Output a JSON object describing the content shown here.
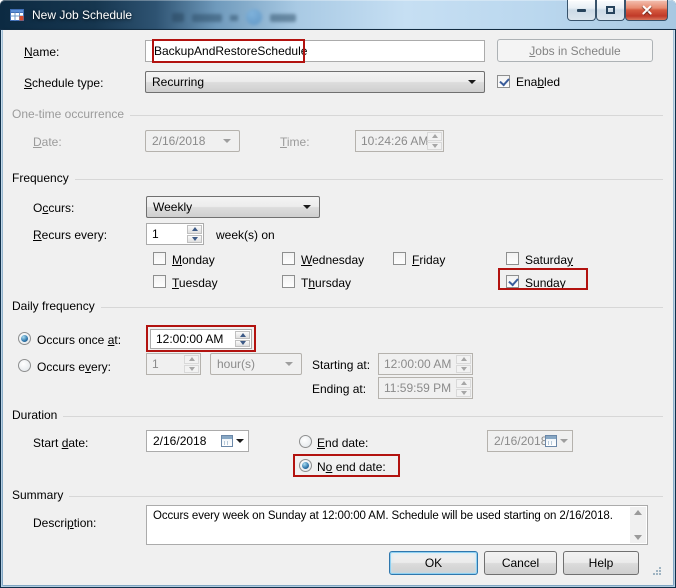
{
  "colors": {
    "annotation": "#b2120f",
    "titlebar_accent": "#a9cae4",
    "client_bg": "#f0f0f0"
  },
  "window": {
    "title": "New Job Schedule"
  },
  "icons": {
    "app": "schedule-grid-icon",
    "minimize": "minimize-icon",
    "maximize": "maximize-icon",
    "close": "close-icon",
    "combo_arrow": "chevron-down-icon",
    "calendar": "calendar-icon",
    "spin_up": "arrow-up-icon",
    "spin_down": "arrow-down-icon",
    "resize": "resize-grip-icon"
  },
  "header": {
    "name_label": "&Name:",
    "name_value": "BackupAndRestoreSchedule",
    "jobs_in_schedule_button": "&Jobs in Schedule",
    "schedule_type_label": "&Schedule type:",
    "schedule_type_value": "Recurring",
    "enabled_label": "Ena&bled",
    "enabled_checked": true
  },
  "one_time": {
    "title": "One-time occurrence",
    "date_label": "&Date:",
    "date_value": "2/16/2018",
    "time_label": "&Time:",
    "time_value": "10:24:26 AM"
  },
  "frequency": {
    "title": "Frequency",
    "occurs_label": "O&ccurs:",
    "occurs_value": "Weekly",
    "recurs_label": "&Recurs every:",
    "recurs_value": "1",
    "recurs_suffix": "week(s) on",
    "days": [
      {
        "label": "&Monday",
        "checked": false
      },
      {
        "label": "&Tuesday",
        "checked": false
      },
      {
        "label": "&Wednesday",
        "checked": false
      },
      {
        "label": "T&hursday",
        "checked": false
      },
      {
        "label": "&Friday",
        "checked": false
      },
      {
        "label": "Saturda&y",
        "checked": false
      },
      {
        "label": "S&unday",
        "checked": true
      }
    ]
  },
  "daily": {
    "title": "Daily frequency",
    "once_label": "Occurs once &at:",
    "once_selected": true,
    "once_value": "12:00:00 AM",
    "every_label": "Occurs e&very:",
    "every_selected": false,
    "every_value": "1",
    "every_unit": "hour(s)",
    "starting_label": "Startin&g at:",
    "starting_value": "12:00:00 AM",
    "ending_label": "Endin&g at:",
    "ending_value": "11:59:59 PM"
  },
  "duration": {
    "title": "Duration",
    "start_label": "Start &date:",
    "start_value": "2/16/2018",
    "end_label": "&End date:",
    "end_selected": false,
    "end_value": "2/16/2018",
    "no_end_label": "N&o end date:",
    "no_end_selected": true
  },
  "summary": {
    "title": "Summary",
    "description_label": "Descri&ption:",
    "description": "Occurs every week on Sunday at 12:00:00 AM. Schedule will be used starting on 2/16/2018."
  },
  "footer": {
    "ok": "OK",
    "cancel": "Cancel",
    "help": "Help"
  }
}
